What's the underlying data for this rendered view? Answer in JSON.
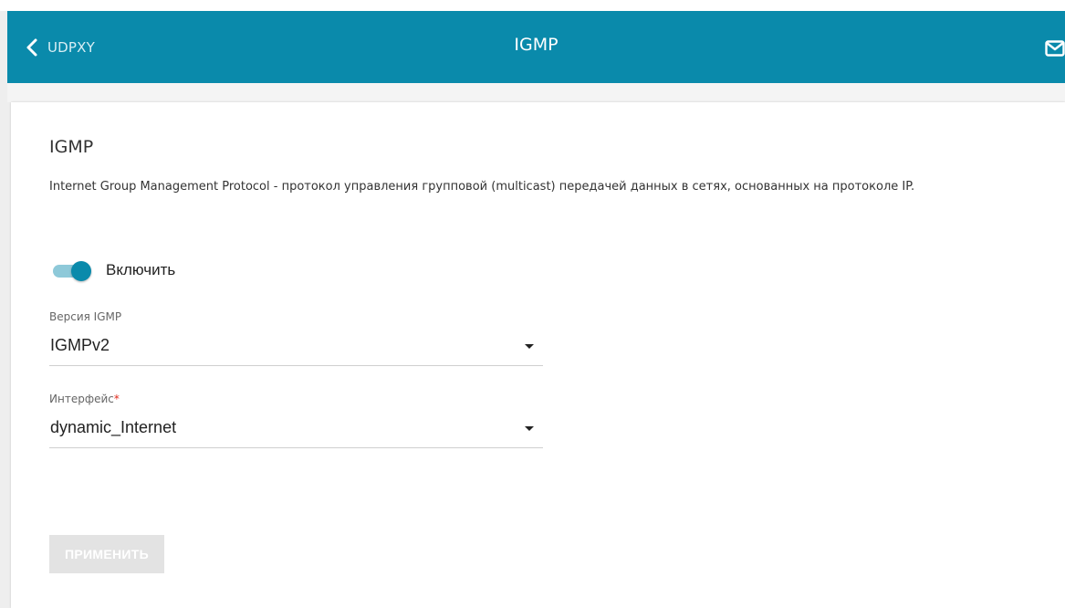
{
  "header": {
    "back_label": "UDPXY",
    "title": "IGMP"
  },
  "section": {
    "title": "IGMP",
    "description": "Internet Group Management Protocol - протокол управления групповой (multicast) передачей данных в сетях, основанных на протоколе IP."
  },
  "enable_toggle": {
    "label": "Включить",
    "state": "on"
  },
  "igmp_version": {
    "label": "Версия IGMP",
    "value": "IGMPv2"
  },
  "interface": {
    "label": "Интерфейс",
    "required_mark": "*",
    "value": "dynamic_Internet"
  },
  "apply_button": {
    "label": "ПРИМЕНИТЬ",
    "state": "disabled"
  },
  "colors": {
    "header_bg": "#0a8aab",
    "toggle_on": "#0a8aab",
    "required": "#e0291b",
    "button_disabled": "#e3e3e3"
  },
  "icons": [
    "chevron-left-icon",
    "mail-icon",
    "caret-down-icon"
  ]
}
